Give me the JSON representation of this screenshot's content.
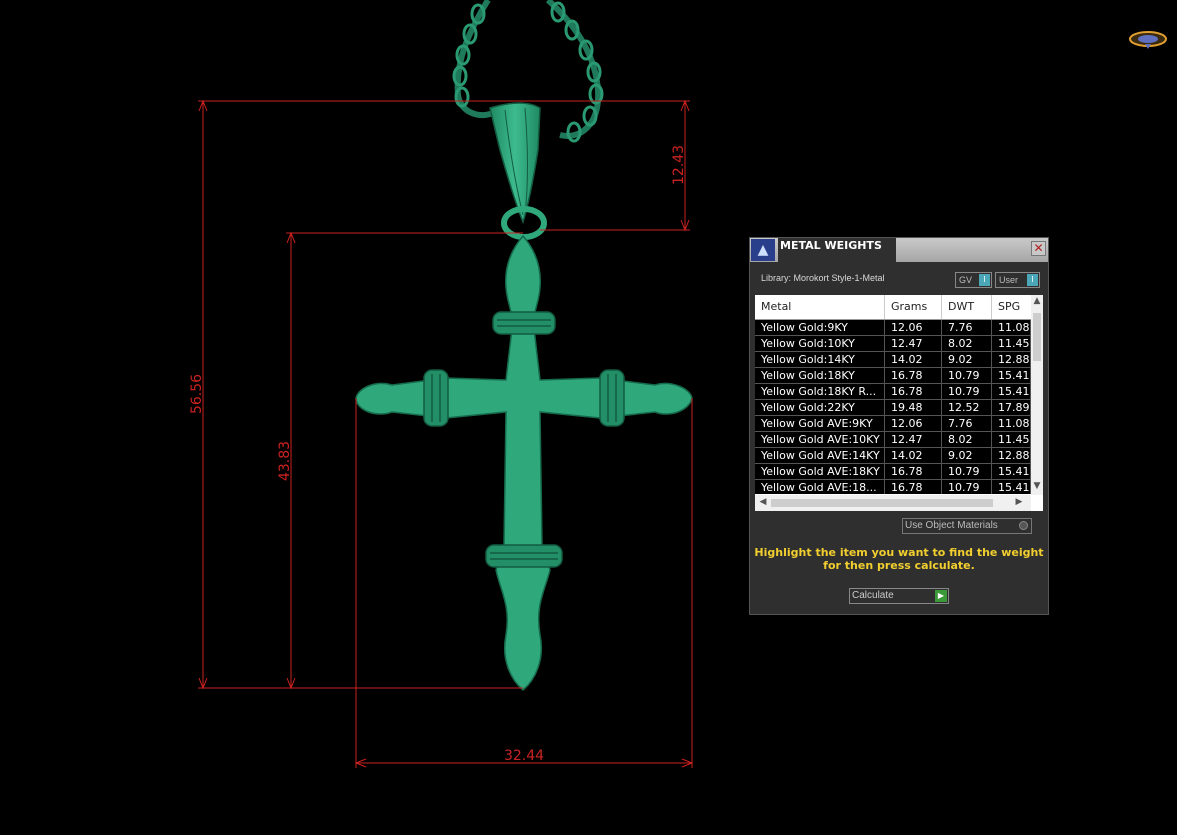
{
  "viewport": {
    "dimensions": [
      {
        "id": "overall-height",
        "value": "56.56"
      },
      {
        "id": "bail-height",
        "value": "12.43"
      },
      {
        "id": "cross-height",
        "value": "43.83"
      },
      {
        "id": "cross-width",
        "value": "32.44"
      }
    ],
    "colors": {
      "background": "#000000",
      "dimension": "#cc2222",
      "model": "#2fa87c",
      "chain": "#1f7a5c"
    }
  },
  "panel": {
    "title": "METAL WEIGHTS",
    "close_icon": "close-icon",
    "library_label": "Library: Morokort Style-1-Metal",
    "gv_label": "GV",
    "user_label": "User",
    "columns": [
      "Metal",
      "Grams",
      "DWT",
      "SPG"
    ],
    "rows": [
      [
        "Yellow Gold:9KY",
        "12.06",
        "7.76",
        "11.08"
      ],
      [
        "Yellow Gold:10KY",
        "12.47",
        "8.02",
        "11.45"
      ],
      [
        "Yellow Gold:14KY",
        "14.02",
        "9.02",
        "12.88"
      ],
      [
        "Yellow Gold:18KY",
        "16.78",
        "10.79",
        "15.41"
      ],
      [
        "Yellow Gold:18KY R...",
        "16.78",
        "10.79",
        "15.41"
      ],
      [
        "Yellow Gold:22KY",
        "19.48",
        "12.52",
        "17.89"
      ],
      [
        "Yellow Gold AVE:9KY",
        "12.06",
        "7.76",
        "11.08"
      ],
      [
        "Yellow Gold AVE:10KY",
        "12.47",
        "8.02",
        "11.45"
      ],
      [
        "Yellow Gold AVE:14KY",
        "14.02",
        "9.02",
        "12.88"
      ],
      [
        "Yellow Gold AVE:18KY",
        "16.78",
        "10.79",
        "15.41"
      ],
      [
        "Yellow Gold AVE:18...",
        "16.78",
        "10.79",
        "15.41"
      ]
    ],
    "use_object_materials": "Use Object Materials",
    "instruction_line1": "Highlight the item you want to find the weight",
    "instruction_line2": "for then press calculate.",
    "calculate_label": "Calculate",
    "colors": {
      "panel_bg": "#2f2f2f",
      "instruction": "#f2cf2f",
      "accent": "#4aa7b8"
    }
  }
}
